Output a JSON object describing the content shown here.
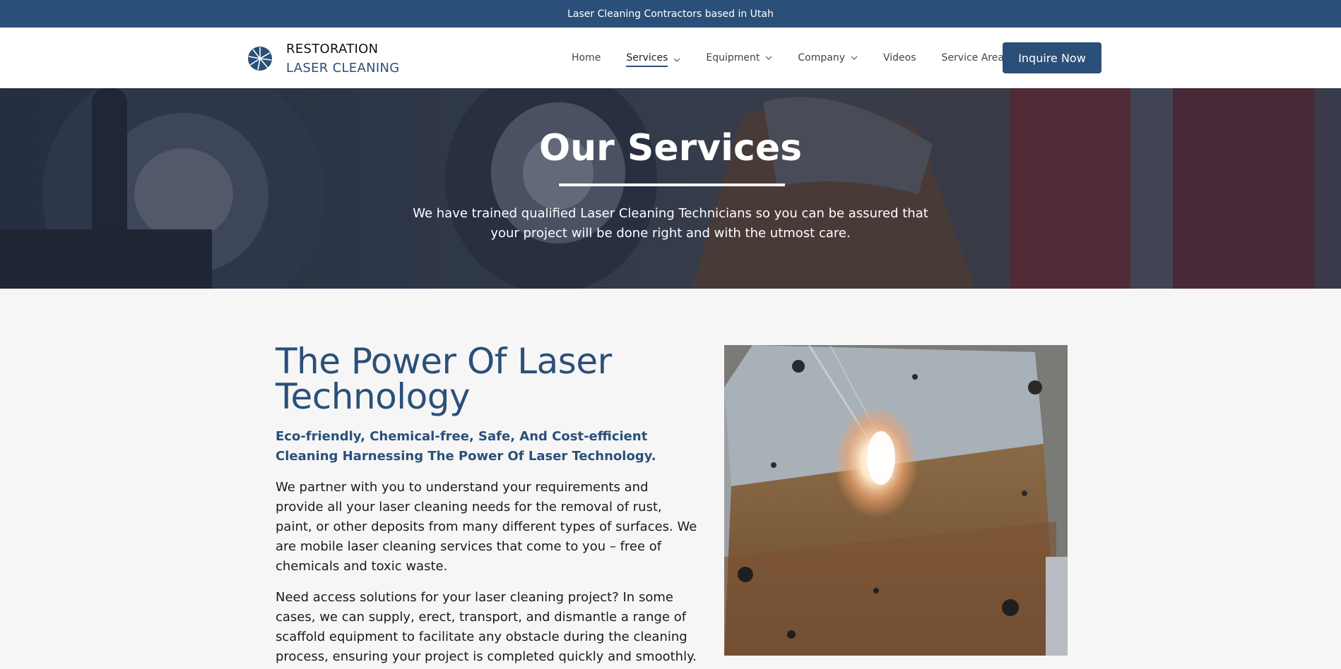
{
  "topbar": {
    "text": "Laser Cleaning Contractors based in Utah"
  },
  "logo": {
    "line1": "RESTORATION",
    "line2": "LASER CLEANING",
    "icon": "laser-burst-icon"
  },
  "nav": {
    "items": [
      {
        "label": "Home",
        "has_dropdown": false
      },
      {
        "label": "Services",
        "has_dropdown": true,
        "active": true
      },
      {
        "label": "Equipment",
        "has_dropdown": true
      },
      {
        "label": "Company",
        "has_dropdown": true
      },
      {
        "label": "Videos",
        "has_dropdown": false
      },
      {
        "label": "Service Area",
        "has_dropdown": false
      }
    ],
    "cta": "Inquire Now"
  },
  "hero": {
    "title": "Our Services",
    "subtitle": "We have trained qualified Laser Cleaning Technicians so you can be assured that your project will be done right and with the utmost care."
  },
  "main": {
    "heading": "The Power Of Laser Technology",
    "subheading": "Eco-friendly, Chemical-free, Safe, And Cost-efficient Cleaning Harnessing The Power Of Laser Technology.",
    "paragraphs": [
      "We partner with you to understand your requirements and provide all your laser cleaning needs for the removal of rust, paint, or other deposits from many different types of surfaces. We are mobile laser cleaning services that come to you – free of chemicals and toxic waste.",
      "Need access solutions for your laser cleaning project? In some cases, we can supply, erect, transport, and dismantle a range of scaffold equipment to facilitate any obstacle during the cleaning process, ensuring your project is completed quickly and smoothly."
    ]
  },
  "colors": {
    "brand": "#2a5079",
    "background": "#f6f6f6"
  }
}
